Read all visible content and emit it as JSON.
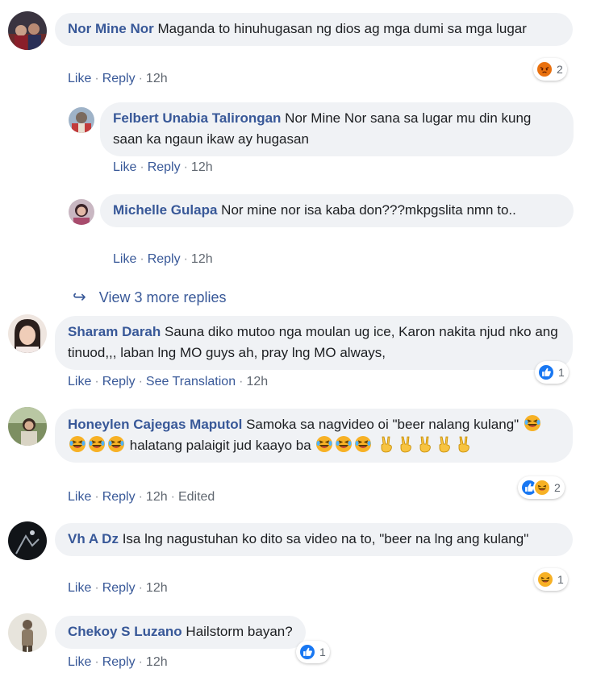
{
  "comments": [
    {
      "name": "Nor Mine Nor",
      "text": "Maganda to hinuhugasan ng dios ag mga dumi sa mga lugar",
      "like": "Like",
      "reply": "Reply",
      "time": "12h",
      "reactions": {
        "icons": [
          "angry"
        ],
        "count": "2"
      }
    },
    {
      "name": "Felbert Unabia Talirongan",
      "text": "Nor Mine Nor sana sa lugar mu din kung saan ka ngaun ikaw ay hugasan",
      "like": "Like",
      "reply": "Reply",
      "time": "12h"
    },
    {
      "name": "Michelle Gulapa",
      "text": "Nor mine nor isa kaba don???mkpgslita nmn to..",
      "like": "Like",
      "reply": "Reply",
      "time": "12h"
    },
    {
      "name": "Sharam Darah",
      "text": "Sauna diko mutoo nga moulan ug ice, Karon nakita njud nko ang tinuod,,, laban lng MO guys ah, pray lng MO always,",
      "like": "Like",
      "reply": "Reply",
      "translate": "See Translation",
      "time": "12h",
      "reactions": {
        "icons": [
          "like"
        ],
        "count": "1"
      }
    },
    {
      "name": "Honeylen Cajegas Maputol",
      "text_a": "Samoka sa nagvideo oi \"beer nalang kulang\"",
      "text_b": "halatang palaigit jud kaayo ba",
      "like": "Like",
      "reply": "Reply",
      "time": "12h",
      "edited": "Edited",
      "reactions": {
        "icons": [
          "like",
          "haha"
        ],
        "count": "2"
      }
    },
    {
      "name": "Vh A Dz",
      "text": "Isa lng nagustuhan ko dito sa video na to, \"beer na lng ang kulang\"",
      "like": "Like",
      "reply": "Reply",
      "time": "12h",
      "reactions": {
        "icons": [
          "haha"
        ],
        "count": "1"
      }
    },
    {
      "name": "Chekoy S Luzano",
      "text": "Hailstorm bayan?",
      "like": "Like",
      "reply": "Reply",
      "time": "12h",
      "reactions": {
        "icons": [
          "like"
        ],
        "count": "1"
      }
    }
  ],
  "view_more": "View 3 more replies",
  "colors": {
    "link": "#385898",
    "bubble": "#f0f2f5",
    "like": "#1877f2",
    "haha": "#f7b125",
    "angry": "#e9710f"
  }
}
